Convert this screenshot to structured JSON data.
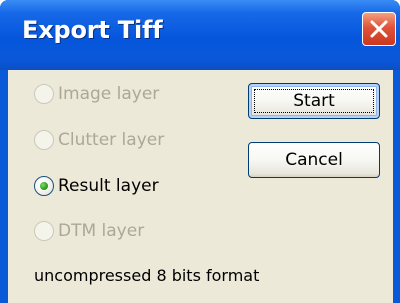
{
  "window": {
    "title": "Export Tiff"
  },
  "radios": [
    {
      "label": "Image layer",
      "enabled": false,
      "selected": false
    },
    {
      "label": "Clutter layer",
      "enabled": false,
      "selected": false
    },
    {
      "label": "Result layer",
      "enabled": true,
      "selected": true
    },
    {
      "label": "DTM layer",
      "enabled": false,
      "selected": false
    }
  ],
  "buttons": {
    "start_label": "Start",
    "cancel_label": "Cancel"
  },
  "status_text": "uncompressed 8 bits format",
  "icons": {
    "close": "close-icon"
  },
  "colors": {
    "titlebar": "#0556dc",
    "close_button": "#e0533a",
    "dialog_background": "#ece9d8",
    "disabled_text": "#aca899",
    "radio_selected": "#2c9e1e"
  }
}
